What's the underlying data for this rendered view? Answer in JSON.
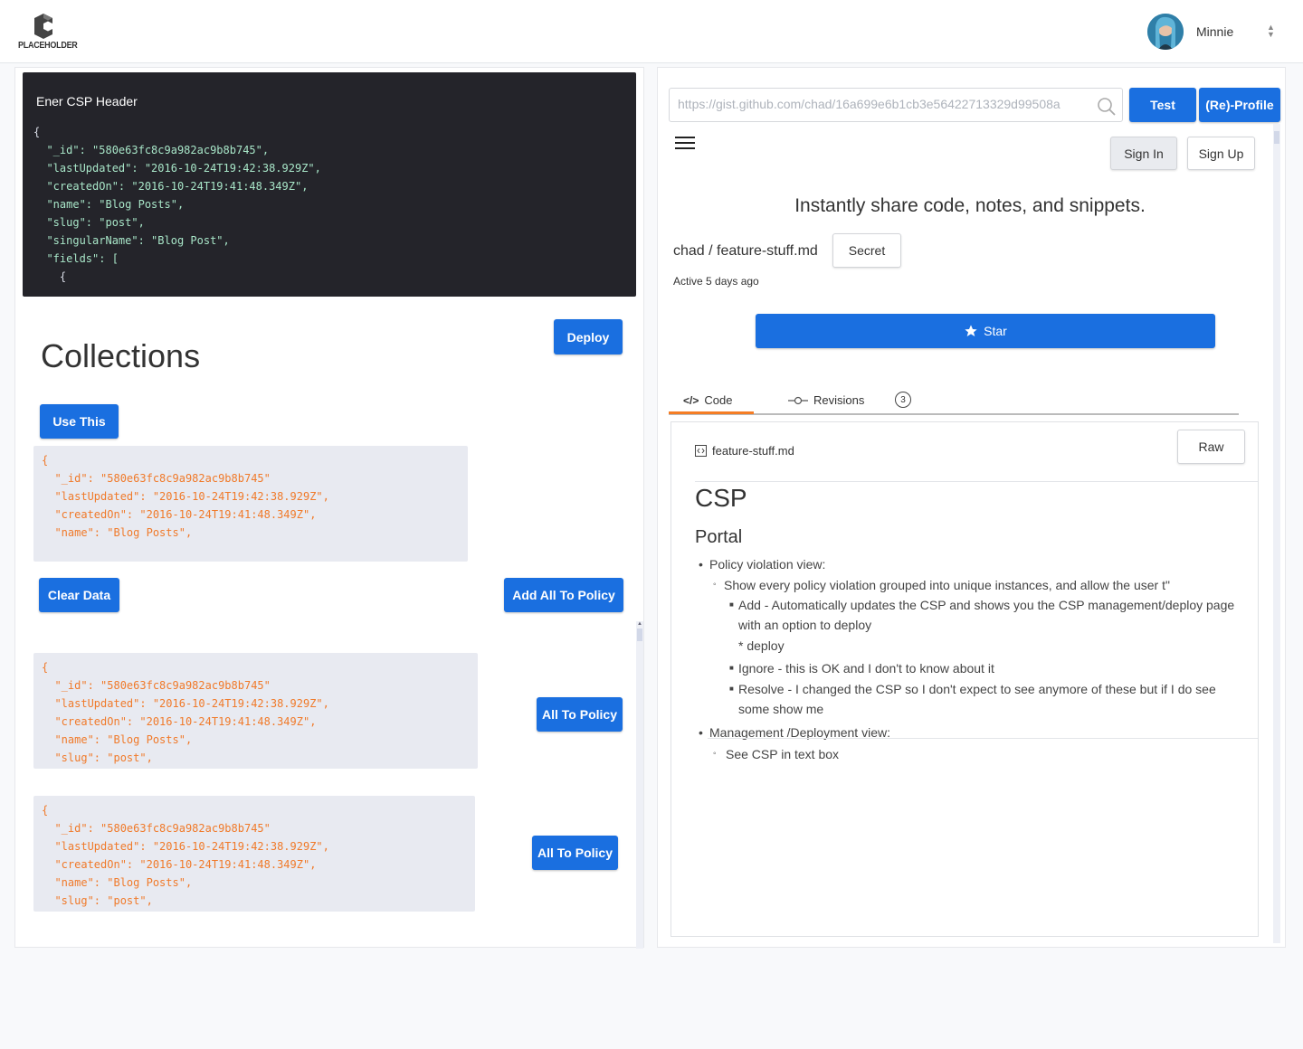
{
  "brand": {
    "logo_text": "PLACEHOLDER"
  },
  "user": {
    "name": "Minnie"
  },
  "left": {
    "csp_header": {
      "title": "Ener CSP Header",
      "lines": [
        "{",
        "  \"_id\": \"580e63fc8c9a982ac9b8b745\",",
        "  \"lastUpdated\": \"2016-10-24T19:42:38.929Z\",",
        "  \"createdOn\": \"2016-10-24T19:41:48.349Z\",",
        "  \"name\": \"Blog Posts\",",
        "  \"slug\": \"post\",",
        "  \"singularName\": \"Blog Post\",",
        "  \"fields\": [",
        "    {"
      ]
    },
    "deploy_label": "Deploy",
    "collections_title": "Collections",
    "use_this_label": "Use This",
    "block1_lines": [
      "{",
      "  \"_id\": \"580e63fc8c9a982ac9b8b745\"",
      "  \"lastUpdated\": \"2016-10-24T19:42:38.929Z\",",
      "  \"createdOn\": \"2016-10-24T19:41:48.349Z\",",
      "  \"name\": \"Blog Posts\","
    ],
    "clear_data_label": "Clear Data",
    "add_all_label": "Add All To Policy",
    "block2_lines": [
      "{",
      "  \"_id\": \"580e63fc8c9a982ac9b8b745\"",
      "  \"lastUpdated\": \"2016-10-24T19:42:38.929Z\",",
      "  \"createdOn\": \"2016-10-24T19:41:48.349Z\",",
      "  \"name\": \"Blog Posts\",",
      "  \"slug\": \"post\","
    ],
    "all_to_policy_label_1": "All To Policy",
    "block3_lines": [
      "{",
      "  \"_id\": \"580e63fc8c9a982ac9b8b745\"",
      "  \"lastUpdated\": \"2016-10-24T19:42:38.929Z\",",
      "  \"createdOn\": \"2016-10-24T19:41:48.349Z\",",
      "  \"name\": \"Blog Posts\",",
      "  \"slug\": \"post\","
    ],
    "all_to_policy_label_2": "All To Policy"
  },
  "right": {
    "search_placeholder": "https://gist.github.com/chad/16a699e6b1cb3e56422713329d99508a",
    "test_label": "Test",
    "reprofile_label": "(Re)-Profile",
    "sign_in_label": "Sign In",
    "sign_up_label": "Sign Up",
    "tagline": "Instantly share code, notes, and snippets.",
    "repo": "chad / feature-stuff.md",
    "secret_label": "Secret",
    "active_text": "Active 5 days ago",
    "star_label": "Star",
    "tabs": {
      "code": "Code",
      "revisions": "Revisions",
      "revisions_count": "3"
    },
    "file": {
      "name": "feature-stuff.md",
      "raw_label": "Raw",
      "h1": "CSP",
      "h2": "Portal",
      "li1": "Policy violation view:",
      "li1_1": "Show every policy violation grouped into unique instances, and allow the user t\"",
      "li1_1_a1": "Add - Automatically updates the CSP and shows you the CSP management/deploy page",
      "li1_1_a2": "with an option to deploy",
      "li1_1_a3": "* deploy",
      "li1_1_b": "Ignore - this is OK and I don't to know about it",
      "li1_1_c1": "Resolve - I changed the CSP so I don't expect to see anymore of these but if I do see",
      "li1_1_c2": "some show me",
      "li2": "Management /Deployment view:",
      "li2_1": "See CSP in text box"
    }
  },
  "colors": {
    "primary": "#1a6fe0",
    "accent_orange": "#f57d25",
    "code_dark_bg": "#24242a",
    "code_light_bg": "#e8eaf1"
  }
}
